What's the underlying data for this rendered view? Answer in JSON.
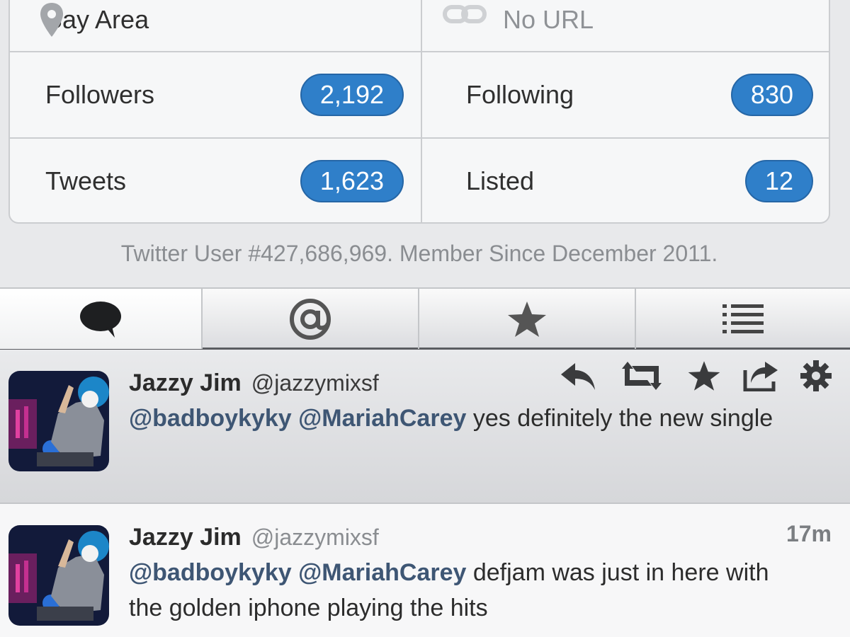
{
  "profile": {
    "location": "Bay Area",
    "url": "No URL",
    "stats": [
      {
        "label": "Followers",
        "value": "2,192"
      },
      {
        "label": "Following",
        "value": "830"
      },
      {
        "label": "Tweets",
        "value": "1,623"
      },
      {
        "label": "Listed",
        "value": "12"
      }
    ],
    "member_line": "Twitter User #427,686,969. Member Since December 2011."
  },
  "tabs": [
    {
      "icon": "speech-bubble-icon",
      "active": true
    },
    {
      "icon": "at-sign-icon",
      "glyph": "@"
    },
    {
      "icon": "star-icon"
    },
    {
      "icon": "list-icon"
    }
  ],
  "tweets": [
    {
      "name": "Jazzy Jim",
      "handle": "@jazzymixsf",
      "mention1": "@badboykyky",
      "mention2": "@MariahCarey",
      "text": " yes definitely the new single",
      "actions": [
        "reply-icon",
        "retweet-icon",
        "favorite-icon",
        "share-icon",
        "gear-icon"
      ]
    },
    {
      "name": "Jazzy Jim",
      "handle": "@jazzymixsf",
      "mention1": "@badboykyky",
      "mention2": "@MariahCarey",
      "text": " defjam was just in here with the golden iphone playing the hits",
      "time": "17m"
    }
  ],
  "colors": {
    "badge": "#2f7fc9",
    "mention": "#3e5674",
    "background": "#e8e9eb"
  }
}
